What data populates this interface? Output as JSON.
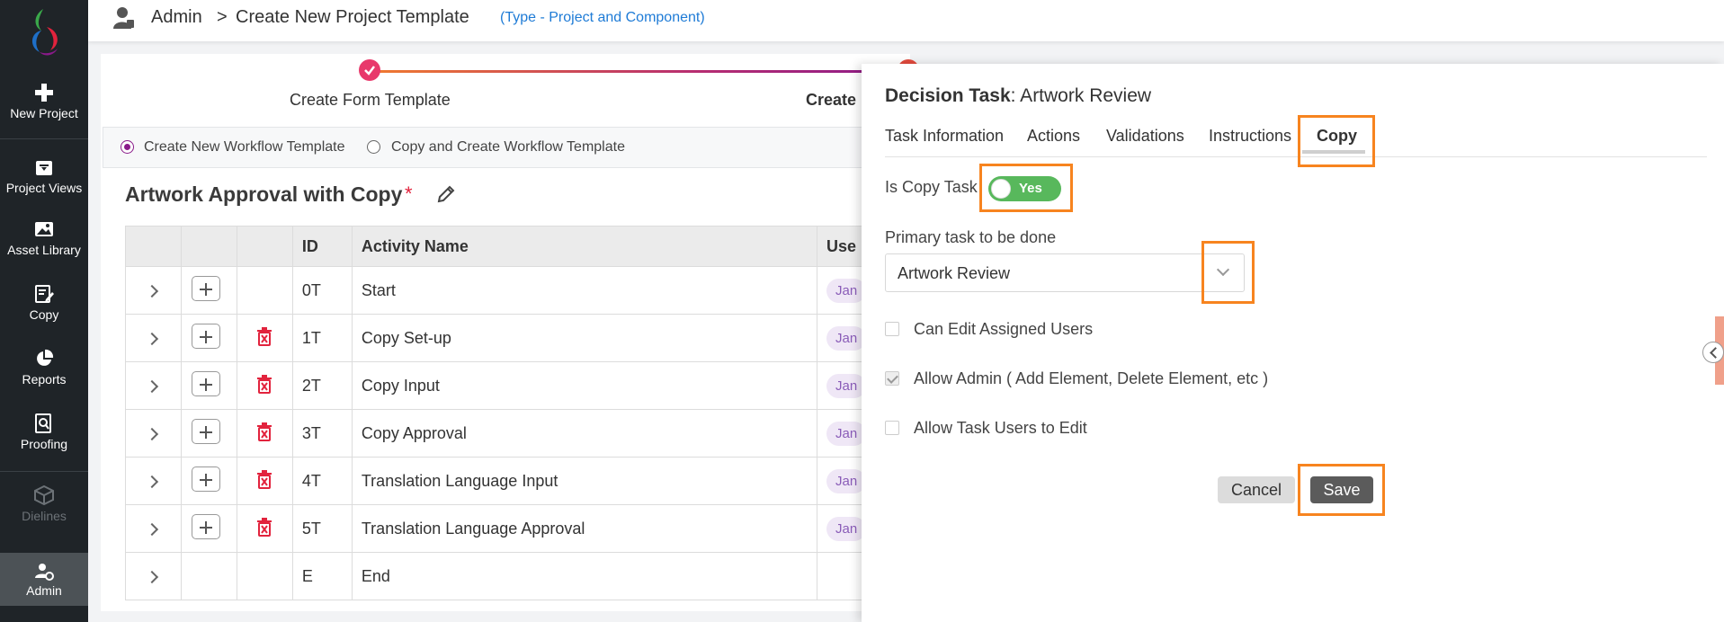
{
  "sidebar": {
    "items": [
      {
        "label": "New Project",
        "icon": "plus-icon"
      },
      {
        "label": "Project Views",
        "icon": "inbox-icon"
      },
      {
        "label": "Asset Library",
        "icon": "image-icon"
      },
      {
        "label": "Copy",
        "icon": "edit-document-icon"
      },
      {
        "label": "Reports",
        "icon": "pie-chart-icon"
      },
      {
        "label": "Proofing",
        "icon": "magnify-document-icon"
      },
      {
        "label": "Dielines",
        "icon": "box-icon"
      },
      {
        "label": "Admin",
        "icon": "user-gear-icon"
      }
    ]
  },
  "header": {
    "crumb_admin": "Admin",
    "crumb_sep": ">",
    "crumb_title": "Create New Project Template",
    "type_note": "(Type - Project and Component)"
  },
  "stepper": {
    "step1": "Create Form Template",
    "step2": "Create"
  },
  "workflow_options": {
    "option1": "Create New Workflow Template",
    "option2": "Copy and Create Workflow Template"
  },
  "workflow": {
    "title": "Artwork Approval with Copy",
    "required_mark": "*"
  },
  "table": {
    "headers": {
      "id": "ID",
      "activity": "Activity Name",
      "users": "Use"
    },
    "rows": [
      {
        "id": "0T",
        "name": "Start",
        "user": "Jan"
      },
      {
        "id": "1T",
        "name": "Copy Set-up",
        "user": "Jan"
      },
      {
        "id": "2T",
        "name": "Copy Input",
        "user": "Jan"
      },
      {
        "id": "3T",
        "name": "Copy Approval",
        "user": "Jan"
      },
      {
        "id": "4T",
        "name": "Translation Language Input",
        "user": "Jan"
      },
      {
        "id": "5T",
        "name": "Translation Language Approval",
        "user": "Jan"
      },
      {
        "id": "E",
        "name": "End",
        "user": ""
      }
    ]
  },
  "panel": {
    "title_prefix": "Decision Task",
    "title_suffix": ": Artwork Review",
    "tabs": [
      "Task Information",
      "Actions",
      "Validations",
      "Instructions",
      "Copy"
    ],
    "is_copy_label": "Is Copy Task",
    "is_copy_value": "Yes",
    "primary_label": "Primary task to be done",
    "primary_value": "Artwork Review",
    "cb_edit_users": "Can Edit Assigned Users",
    "cb_allow_admin": "Allow Admin ( Add Element, Delete Element, etc )",
    "cb_allow_task_users": "Allow Task Users to Edit",
    "cancel": "Cancel",
    "save": "Save"
  },
  "colors": {
    "accent": "#8a1a8a",
    "highlight": "#f7841f",
    "toggle_on": "#58b85c",
    "sidebar": "#1f2428",
    "link": "#1e7bd6"
  }
}
